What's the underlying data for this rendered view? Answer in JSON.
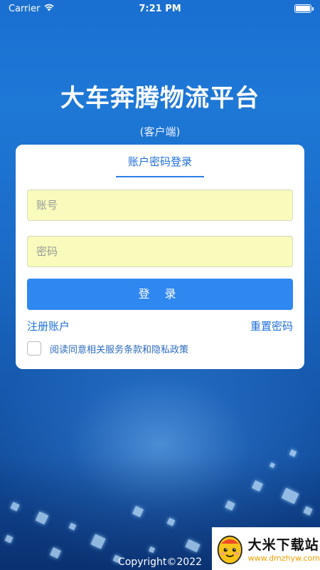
{
  "status_bar": {
    "carrier": "Carrier",
    "time": "7:21 PM",
    "battery_level": 1.0
  },
  "app": {
    "title": "大车奔腾物流平台",
    "subtitle": "(客户端)"
  },
  "login_card": {
    "tab_label": "账户密码登录",
    "account_placeholder": "账号",
    "password_placeholder": "密码",
    "login_button": "登 录",
    "register_link": "注册账户",
    "reset_link": "重置密码",
    "agreement_text": "阅读同意相关服务条款和隐私政策",
    "agreement_checked": false
  },
  "footer": {
    "copyright": "Copyright©2022"
  },
  "watermark": {
    "name": "大米下载站",
    "url": "www.dmzhyw.com"
  },
  "colors": {
    "accent": "#2f87f0",
    "link": "#1e6fd9",
    "input_bg": "#f8fbbb",
    "background_top": "#1a6fd0",
    "background_bottom": "#0e3f86"
  },
  "icons": [
    "wifi-icon",
    "battery-icon",
    "checkbox-icon",
    "watermark-logo-icon"
  ]
}
